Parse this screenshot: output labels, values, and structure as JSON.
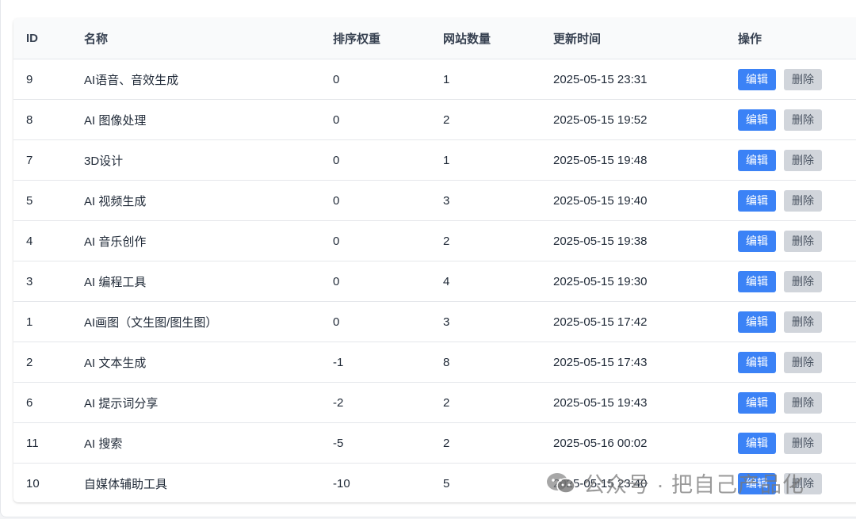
{
  "table": {
    "columns": [
      "ID",
      "名称",
      "排序权重",
      "网站数量",
      "更新时间",
      "操作"
    ],
    "edit_label": "编辑",
    "delete_label": "删除",
    "rows": [
      {
        "id": "9",
        "name": "AI语音、音效生成",
        "weight": "0",
        "count": "1",
        "updated": "2025-05-15 23:31"
      },
      {
        "id": "8",
        "name": "AI 图像处理",
        "weight": "0",
        "count": "2",
        "updated": "2025-05-15 19:52"
      },
      {
        "id": "7",
        "name": "3D设计",
        "weight": "0",
        "count": "1",
        "updated": "2025-05-15 19:48"
      },
      {
        "id": "5",
        "name": "AI 视频生成",
        "weight": "0",
        "count": "3",
        "updated": "2025-05-15 19:40"
      },
      {
        "id": "4",
        "name": "AI 音乐创作",
        "weight": "0",
        "count": "2",
        "updated": "2025-05-15 19:38"
      },
      {
        "id": "3",
        "name": "AI 编程工具",
        "weight": "0",
        "count": "4",
        "updated": "2025-05-15 19:30"
      },
      {
        "id": "1",
        "name": "AI画图（文生图/图生图）",
        "weight": "0",
        "count": "3",
        "updated": "2025-05-15 17:42"
      },
      {
        "id": "2",
        "name": "AI 文本生成",
        "weight": "-1",
        "count": "8",
        "updated": "2025-05-15 17:43"
      },
      {
        "id": "6",
        "name": "AI 提示词分享",
        "weight": "-2",
        "count": "2",
        "updated": "2025-05-15 19:43"
      },
      {
        "id": "11",
        "name": "AI 搜索",
        "weight": "-5",
        "count": "2",
        "updated": "2025-05-16 00:02"
      },
      {
        "id": "10",
        "name": "自媒体辅助工具",
        "weight": "-10",
        "count": "5",
        "updated": "2025-05-15 23:40"
      }
    ]
  },
  "watermark": {
    "text": "公众号 · 把自己产品化",
    "icon": "wechat-icon"
  },
  "colors": {
    "edit_button": "#3b82f6",
    "delete_button": "#d1d5db",
    "header_bg": "#f9fafb"
  }
}
